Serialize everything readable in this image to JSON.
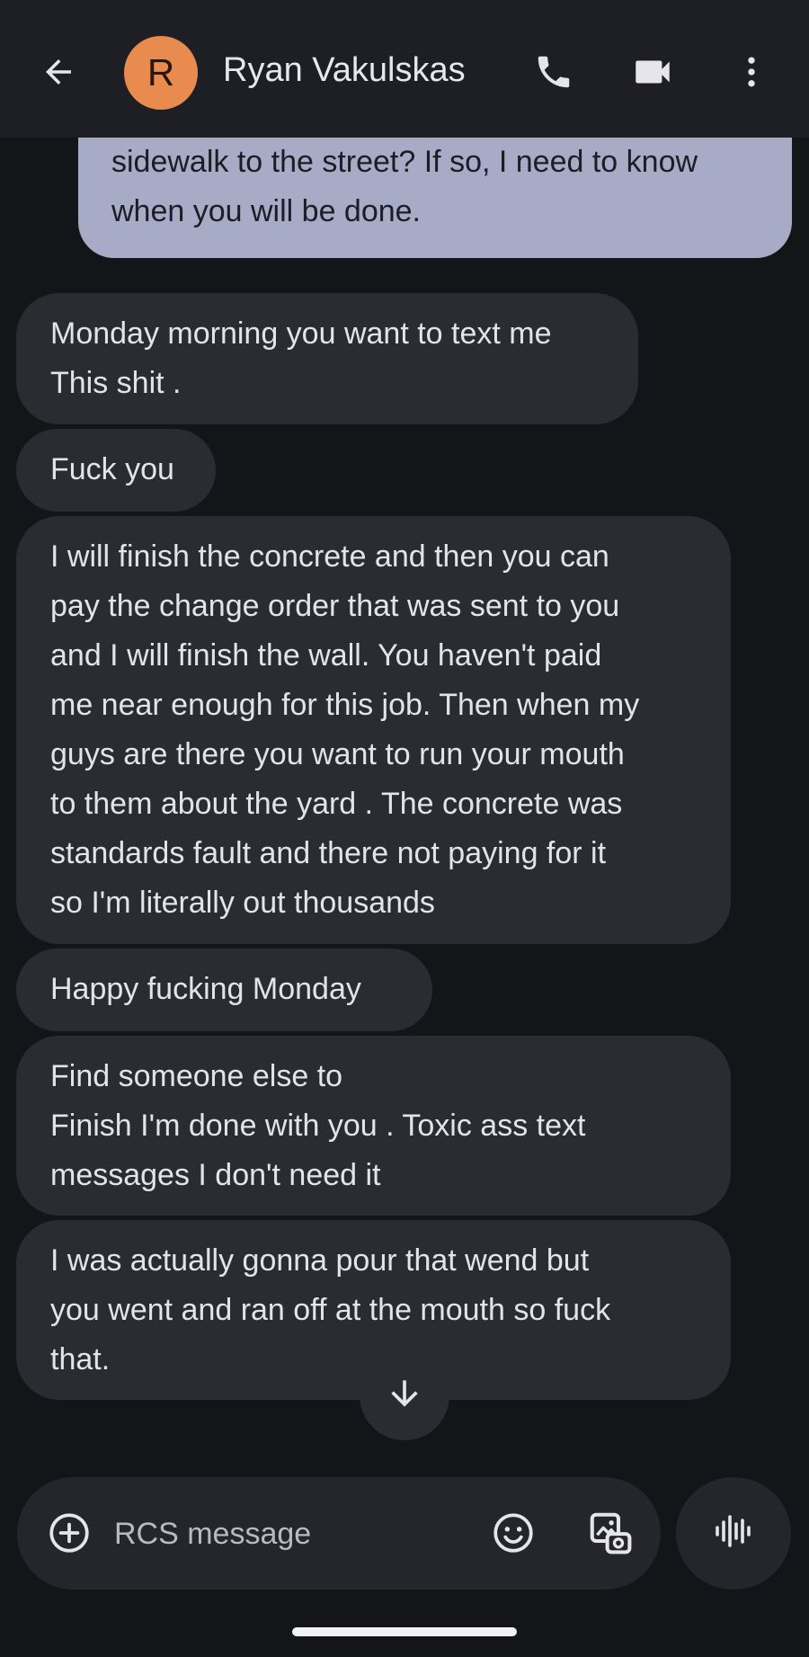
{
  "header": {
    "avatar_letter": "R",
    "contact_name": "Ryan Vakulskas",
    "icons": [
      "back-arrow-icon",
      "phone-icon",
      "video-camera-icon",
      "more-vert-icon"
    ]
  },
  "messages": [
    {
      "direction": "outgoing",
      "text": "sidewalk to the street? If so, I need to know\nwhen you will be done."
    },
    {
      "direction": "incoming",
      "text": "Monday morning you want to text me\nThis shit ."
    },
    {
      "direction": "incoming",
      "text": "Fuck you"
    },
    {
      "direction": "incoming",
      "text": "I will finish the concrete and then you can\npay the change order that was sent to you\nand I will finish the wall. You haven't paid\nme near enough for this job. Then when my\nguys are there you want to run your mouth\nto them about the yard . The concrete was\nstandards fault and there not paying for it\nso I'm literally out thousands"
    },
    {
      "direction": "incoming",
      "text": "Happy fucking Monday"
    },
    {
      "direction": "incoming",
      "text": "Find someone else to\nFinish I'm done with you . Toxic ass text\nmessages I don't need it"
    },
    {
      "direction": "incoming",
      "text": "I was actually gonna pour that wend but\nyou went and ran off at the mouth so fuck\nthat."
    }
  ],
  "composer": {
    "placeholder": "RCS message",
    "value": "",
    "icons": [
      "add-circle-icon",
      "emoji-icon",
      "gallery-icon",
      "voice-waveform-icon"
    ]
  },
  "scroll_button_icon": "arrow-down-icon",
  "colors": {
    "background": "#141519",
    "header": "#1e1f24",
    "incoming_bubble": "#2b2c31",
    "outgoing_bubble": "#a7abc5",
    "avatar": "#e98b4f"
  }
}
